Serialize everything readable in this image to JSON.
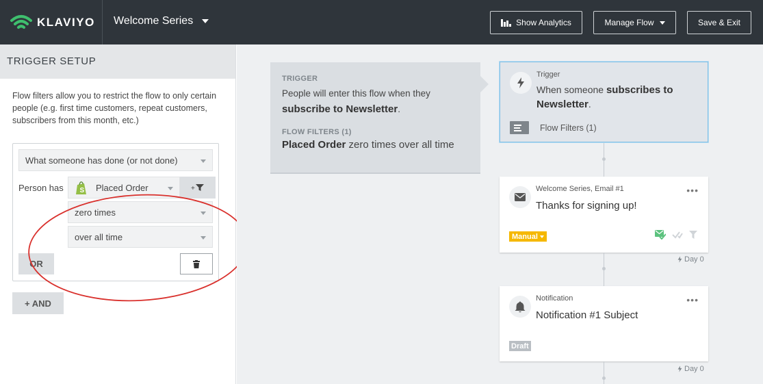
{
  "header": {
    "logo_text": "KLAVIYO",
    "flow_name": "Welcome Series",
    "buttons": {
      "analytics": "Show Analytics",
      "manage": "Manage Flow",
      "save": "Save & Exit"
    }
  },
  "sidebar": {
    "title": "TRIGGER SETUP",
    "description": "Flow filters allow you to restrict the flow to only certain people (e.g. first time customers, repeat customers, subscribers from this month, etc.)",
    "filter": {
      "condition_type": "What someone has done (or not done)",
      "person_has_label": "Person has",
      "metric": "Placed Order",
      "frequency": "zero times",
      "timeframe": "over all time",
      "or_label": "OR"
    },
    "and_label": "+ AND"
  },
  "canvas": {
    "trigger_summary": {
      "trigger_label": "TRIGGER",
      "trigger_text_pre": "People will enter this flow when they",
      "trigger_text_bold": "subscribe to Newsletter",
      "trigger_text_post": ".",
      "filters_label": "FLOW FILTERS (1)",
      "filters_bold": "Placed Order",
      "filters_rest": " zero times over all time"
    },
    "trigger_node": {
      "kind": "Trigger",
      "text_pre": "When someone ",
      "text_bold": "subscribes to Newsletter",
      "text_post": ".",
      "filters_link": "Flow Filters (1)"
    },
    "email_node": {
      "kind": "Welcome Series, Email #1",
      "title": "Thanks for signing up!",
      "status": "Manual",
      "more": "•••",
      "delay": "Day 0"
    },
    "notification_node": {
      "kind": "Notification",
      "title": "Notification #1 Subject",
      "status": "Draft",
      "more": "•••",
      "delay": "Day 0"
    }
  },
  "colors": {
    "topbar": "#2f353b",
    "logo_green": "#3fbf6e",
    "manual_badge": "#f5b800",
    "annotation_red": "#d9302c",
    "selected_border": "#7ec0e6"
  }
}
